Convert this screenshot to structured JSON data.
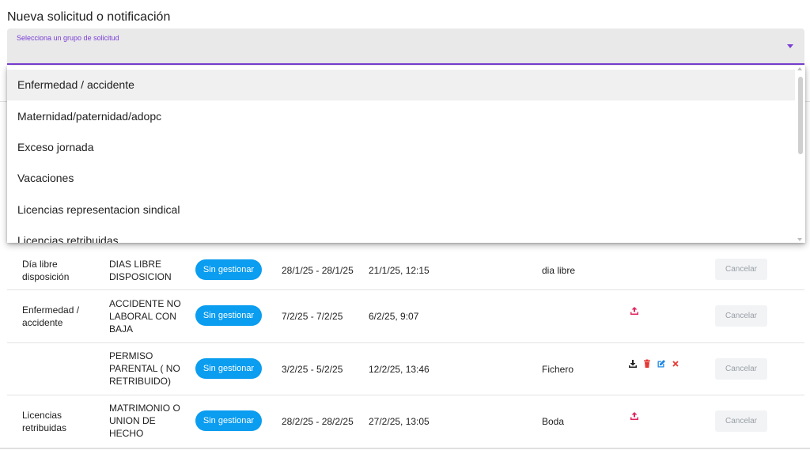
{
  "page": {
    "title": "Nueva solicitud o notificación"
  },
  "select": {
    "label": "Selecciona un grupo de solicitud",
    "selected": ""
  },
  "dropdown": {
    "options": [
      "Enfermedad / accidente",
      "Maternidad/paternidad/adopc",
      "Exceso jornada",
      "Vacaciones",
      "Licencias representacion sindical",
      "Licencias retribuidas"
    ],
    "highlighted_index": 0
  },
  "table": {
    "rows": [
      {
        "type": [
          "Día libre",
          "disposición"
        ],
        "subtype": [
          "DIAS LIBRE",
          "DISPOSICION"
        ],
        "status": "Sin gestionar",
        "dates": "28/1/25 - 28/1/25",
        "created": "21/1/25, 12:15",
        "notes": "dia libre",
        "actions": [],
        "cancel": "Cancelar"
      },
      {
        "type": [
          "Enfermedad /",
          "accidente"
        ],
        "subtype": [
          "ACCIDENTE NO",
          "LABORAL CON",
          "BAJA"
        ],
        "status": "Sin gestionar",
        "dates": "7/2/25 - 7/2/25",
        "created": "6/2/25, 9:07",
        "notes": "",
        "actions": [
          "upload-icon"
        ],
        "cancel": "Cancelar"
      },
      {
        "type": [],
        "subtype": [
          "PERMISO",
          "PARENTAL ( NO",
          "RETRIBUIDO)"
        ],
        "status": "Sin gestionar",
        "dates": "3/2/25 - 5/2/25",
        "created": "12/2/25, 13:46",
        "notes": "Fichero",
        "actions": [
          "download-icon",
          "delete-icon",
          "edit-icon",
          "close-icon"
        ],
        "cancel": "Cancelar"
      },
      {
        "type": [
          "Licencias",
          "retribuidas"
        ],
        "subtype": [
          "MATRIMONIO O",
          "UNION DE",
          "HECHO"
        ],
        "status": "Sin gestionar",
        "dates": "28/2/25 - 28/2/25",
        "created": "27/2/25, 13:05",
        "notes": "Boda",
        "actions": [
          "upload-icon"
        ],
        "cancel": "Cancelar"
      }
    ]
  },
  "colors": {
    "accent": "#7b3fd6",
    "badge": "#0a9df0",
    "upload": "#e0245e",
    "delete": "#e53935",
    "edit": "#1e88e5",
    "close": "#e53935"
  }
}
